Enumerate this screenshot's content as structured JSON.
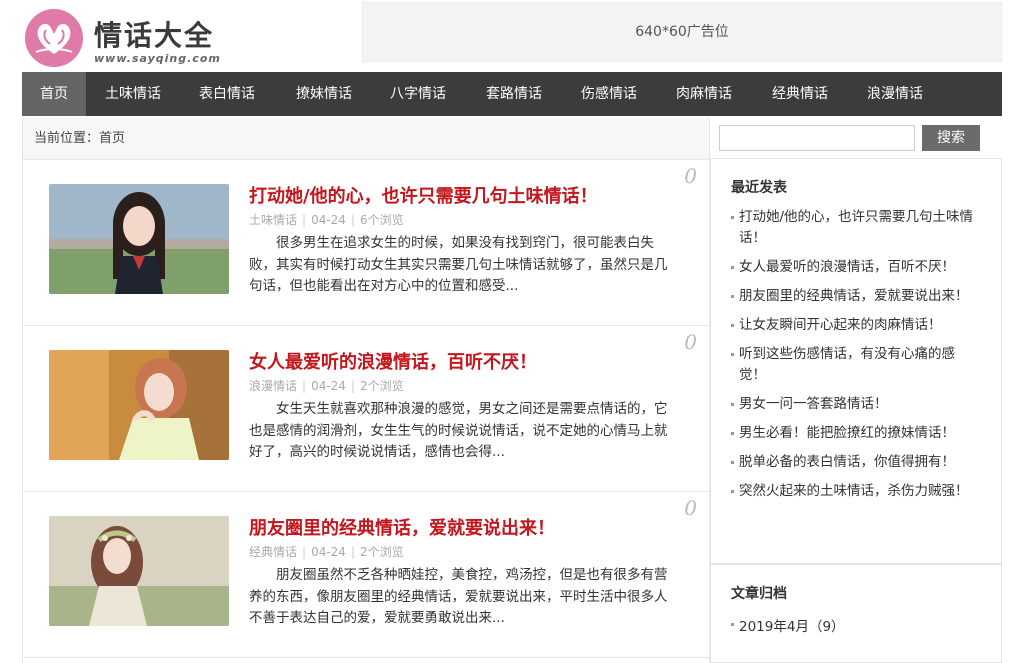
{
  "header": {
    "logo_text": "情话大全",
    "logo_url": "www.sayqing.com",
    "ad_text": "640*60广告位"
  },
  "nav": {
    "items": [
      {
        "label": "首页",
        "active": true
      },
      {
        "label": "土味情话"
      },
      {
        "label": "表白情话"
      },
      {
        "label": "撩妹情话"
      },
      {
        "label": "八字情话"
      },
      {
        "label": "套路情话"
      },
      {
        "label": "伤感情话"
      },
      {
        "label": "肉麻情话"
      },
      {
        "label": "经典情话"
      },
      {
        "label": "浪漫情话"
      }
    ]
  },
  "breadcrumb": "当前位置：首页",
  "articles": [
    {
      "title": "打动她/他的心，也许只需要几句土味情话！",
      "category": "土味情话",
      "date": "04-24",
      "views": "6个浏览",
      "excerpt": "很多男生在追求女生的时候，如果没有找到窍门，很可能表白失败，其实有时候打动女生其实只需要几句土味情话就够了，虽然只是几句话，但也能看出在对方心中的位置和感受...",
      "comments": "0"
    },
    {
      "title": "女人最爱听的浪漫情话，百听不厌！",
      "category": "浪漫情话",
      "date": "04-24",
      "views": "2个浏览",
      "excerpt": "女生天生就喜欢那种浪漫的感觉，男女之间还是需要点情话的，它也是感情的润滑剂，女生生气的时候说说情话，说不定她的心情马上就好了，高兴的时候说说情话，感情也会得...",
      "comments": "0"
    },
    {
      "title": "朋友圈里的经典情话，爱就要说出来！",
      "category": "经典情话",
      "date": "04-24",
      "views": "2个浏览",
      "excerpt": "朋友圈虽然不乏各种晒娃控，美食控，鸡汤控，但是也有很多有营养的东西，像朋友圈里的经典情话，爱就要说出来，平时生活中很多人不善于表达自己的爱，爱就要勇敢说出来...",
      "comments": "0"
    }
  ],
  "sidebar": {
    "search_button": "搜索",
    "search_value": "",
    "recent_title": "最近发表",
    "recent": [
      "打动她/他的心，也许只需要几句土味情话！",
      "女人最爱听的浪漫情话，百听不厌！",
      "朋友圈里的经典情话，爱就要说出来！",
      "让女友瞬间开心起来的肉麻情话！",
      "听到这些伤感情话，有没有心痛的感觉！",
      "男女一问一答套路情话！",
      "男生必看！能把脸撩红的撩妹情话！",
      "脱单必备的表白情话，你值得拥有！",
      "突然火起来的土味情话，杀伤力贼强！"
    ],
    "archive_title": "文章归档",
    "archive": [
      "2019年4月（9）"
    ]
  },
  "colors": {
    "nav_bg": "#3c3c3c",
    "nav_active": "#646464",
    "title_red": "#c4161c",
    "logo_pink": "#e07aa8"
  }
}
